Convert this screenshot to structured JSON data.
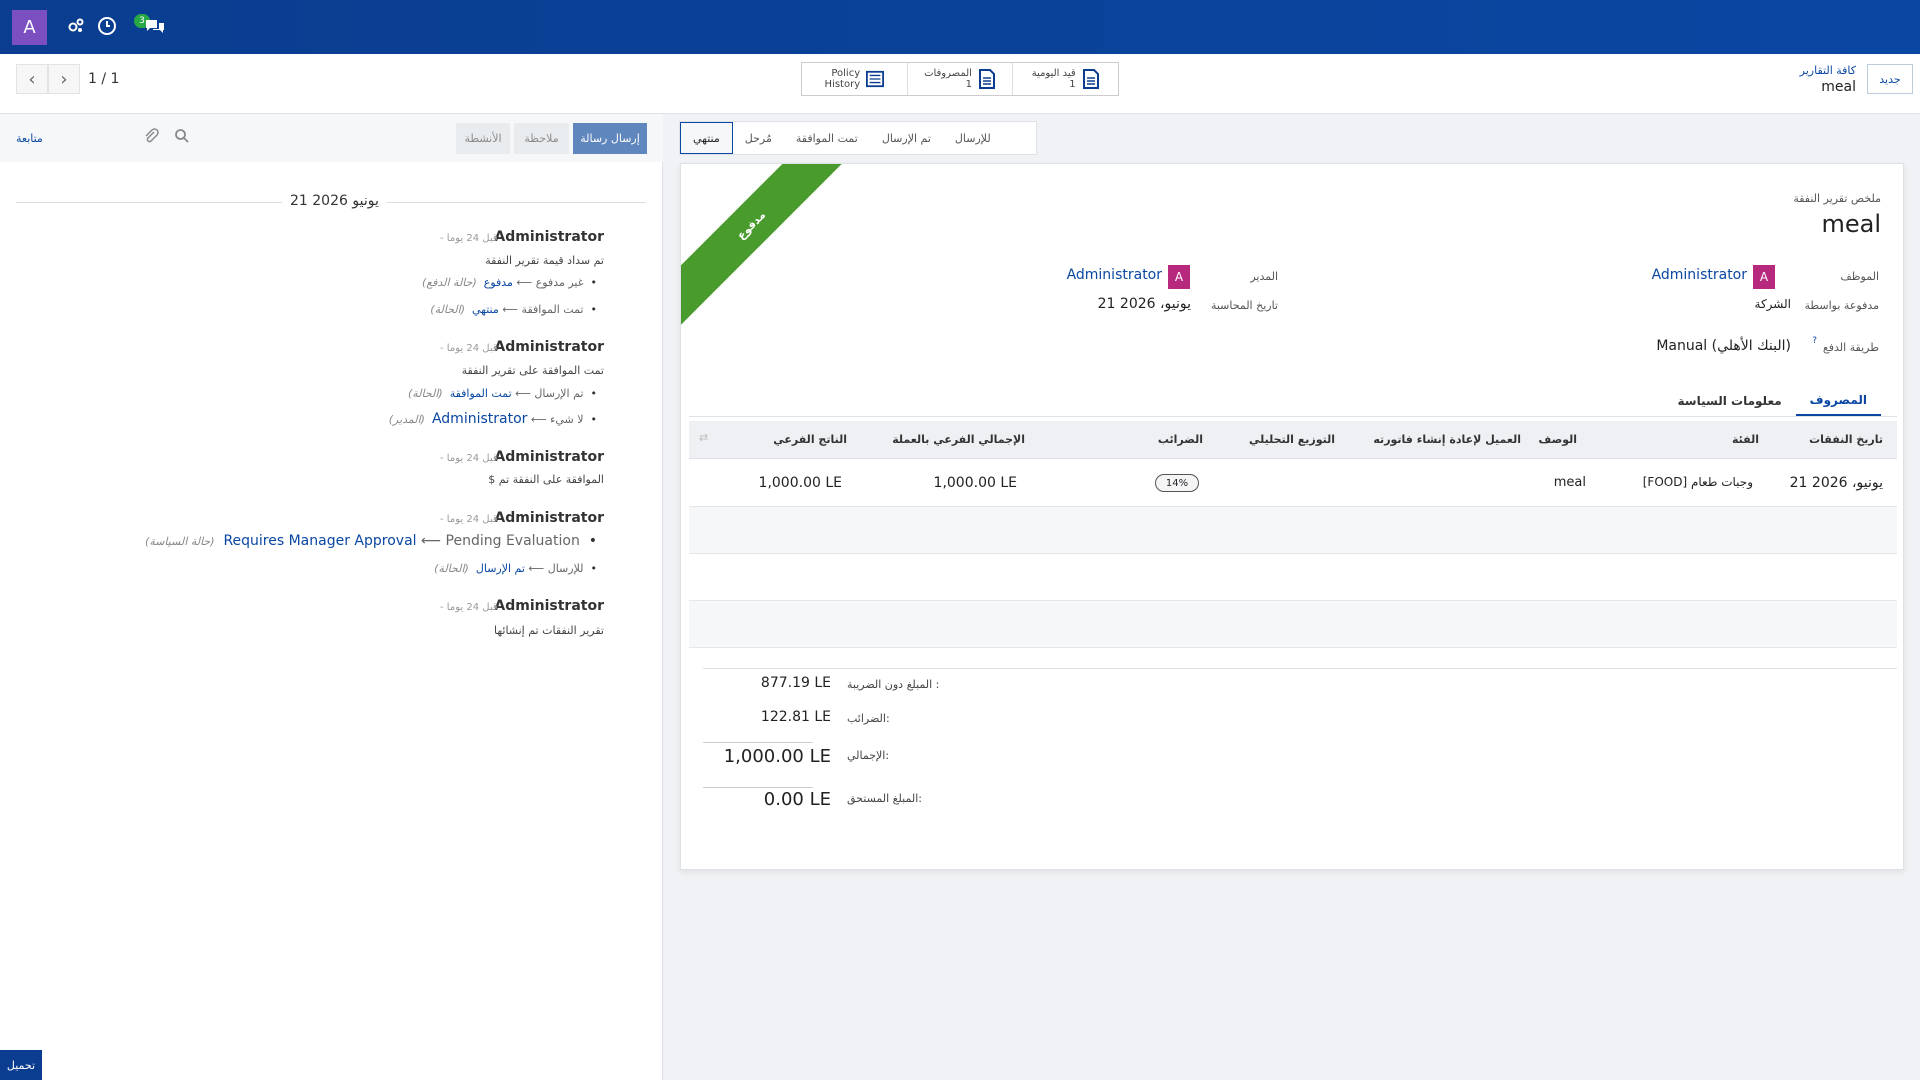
{
  "navbar": {
    "avatar": "A",
    "chat_badge": "3"
  },
  "control": {
    "pager": "1 / 1",
    "breadcrumb_parent": "كافة التقارير",
    "breadcrumb_current": "meal",
    "new_button": "جديد",
    "stats": [
      {
        "label": "قيد اليومية",
        "count": "1",
        "icon": "document-icon"
      },
      {
        "label": "المصروفات",
        "count": "1",
        "icon": "document-icon"
      },
      {
        "label": "Policy",
        "label2": "History",
        "icon": "list-icon"
      }
    ]
  },
  "chatter": {
    "follow": "متابعة",
    "buttons": {
      "send": "إرسال رسالة",
      "note": "ملاحظة",
      "activities": "الأنشطة"
    },
    "date": "21 يونيو 2026",
    "messages": [
      {
        "author": "Administrator",
        "time": "- قبل 24 يوما",
        "body": "تم سداد قيمة تقرير النفقة",
        "changes": [
          {
            "old": "غير مدفوع",
            "new": "مدفوع",
            "field": "(حالة الدفع)"
          },
          {
            "old": "تمت الموافقة",
            "new": "منتهي",
            "field": "(الحالة)"
          }
        ]
      },
      {
        "author": "Administrator",
        "time": "- قبل 24 يوما",
        "body": "تمت الموافقة على تقرير النفقة",
        "changes": [
          {
            "old": "تم الإرسال",
            "new": "تمت الموافقة",
            "field": "(الحالة)"
          },
          {
            "old": "لا شيء",
            "new": "Administrator",
            "field": "(المدير)"
          }
        ]
      },
      {
        "author": "Administrator",
        "time": "- قبل 24 يوما",
        "body": "الموافقة على النفقة تم $"
      },
      {
        "author": "Administrator",
        "time": "- قبل 24 يوما",
        "changes": [
          {
            "old": "Pending Evaluation",
            "new": "Requires Manager Approval",
            "field": "(حالة السياسة)"
          },
          {
            "old": "للإرسال",
            "new": "تم الإرسال",
            "field": "(الحالة)"
          }
        ]
      },
      {
        "author": "Administrator",
        "time": "- قبل 24 يوما",
        "body": "تقرير النفقات تم إنشائها"
      }
    ],
    "upload": "تحميل"
  },
  "statusbar": {
    "states": [
      "للإرسال",
      "تم الإرسال",
      "تمت الموافقة",
      "مُرحل",
      "منتهي"
    ],
    "active": "منتهي"
  },
  "form": {
    "ribbon": "مدفوع",
    "title_label": "ملخص تقرير النفقة",
    "title": "meal",
    "employee_label": "الموظف",
    "employee": "Administrator",
    "employee_avatar": "A",
    "manager_label": "المدير",
    "manager": "Administrator",
    "manager_avatar": "A",
    "paid_by_label": "مدفوعة بواسطة",
    "paid_by": "الشركة",
    "accounting_date_label": "تاريخ المحاسبة",
    "accounting_date": "21 يونيو، 2026",
    "payment_method_label": "طريقة الدفع",
    "payment_help": "?",
    "payment_method": "Manual (البنك الأهلي)",
    "tabs": [
      "المصروف",
      "معلومات السياسة"
    ],
    "active_tab": "المصروف",
    "columns": [
      "تاريخ النفقات",
      "الفئة",
      "الوصف",
      "العميل لإعادة إنشاء فاتورته",
      "التوزيع التحليلي",
      "الضرائب",
      "الإجمالي الفرعي بالعملة",
      "الناتج الفرعي"
    ],
    "row": {
      "date": "21 يونيو، 2026",
      "category": "[FOOD] وجبات طعام",
      "description": "meal",
      "customer": "",
      "analytic": "",
      "tax": "14%",
      "subtotal_currency": "1,000.00 LE",
      "subtotal": "1,000.00 LE"
    },
    "totals": {
      "untaxed_label": "المبلغ دون الضريبة :",
      "untaxed": "877.19 LE",
      "taxes_label": "الضرائب:",
      "taxes": "122.81 LE",
      "total_label": "الإجمالي:",
      "total": "1,000.00 LE",
      "due_label": "المبلغ المستحق:",
      "due": "0.00 LE"
    }
  }
}
